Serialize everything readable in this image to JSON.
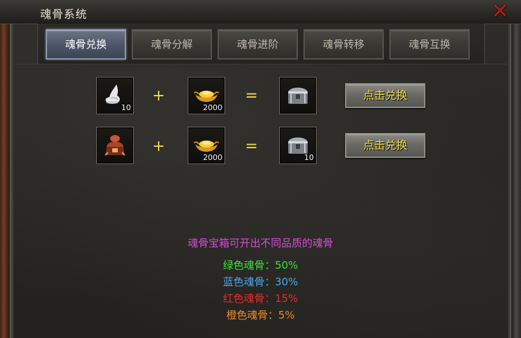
{
  "window": {
    "title": "魂骨系统",
    "close_icon": "close-x-icon"
  },
  "tabs": [
    {
      "label": "魂骨兑换",
      "active": true
    },
    {
      "label": "魂骨分解",
      "active": false
    },
    {
      "label": "魂骨进阶",
      "active": false
    },
    {
      "label": "魂骨转移",
      "active": false
    },
    {
      "label": "魂骨互换",
      "active": false
    }
  ],
  "recipes": [
    {
      "input1": {
        "icon": "soul-bone-icon",
        "qty": "10"
      },
      "plus": "+",
      "input2": {
        "icon": "gold-ingot-icon",
        "qty": "2000"
      },
      "equals": "=",
      "output": {
        "icon": "silver-chest-icon",
        "qty": ""
      },
      "button": "点击兑换"
    },
    {
      "input1": {
        "icon": "soul-bone-chest-icon",
        "qty": ""
      },
      "plus": "+",
      "input2": {
        "icon": "gold-ingot-icon",
        "qty": "2000"
      },
      "equals": "=",
      "output": {
        "icon": "silver-chest-icon",
        "qty": "10"
      },
      "button": "点击兑换"
    }
  ],
  "info": {
    "headline": "魂骨宝箱可开出不同品质的魂骨",
    "headline_color": "#d84ad8",
    "rates": [
      {
        "text": "绿色魂骨：50%",
        "color": "#3ee03e"
      },
      {
        "text": "蓝色魂骨：30%",
        "color": "#4aa8e8"
      },
      {
        "text": "红色魂骨：15%",
        "color": "#e82a2a"
      },
      {
        "text": "橙色魂骨：5%",
        "color": "#f08a2a"
      }
    ]
  }
}
